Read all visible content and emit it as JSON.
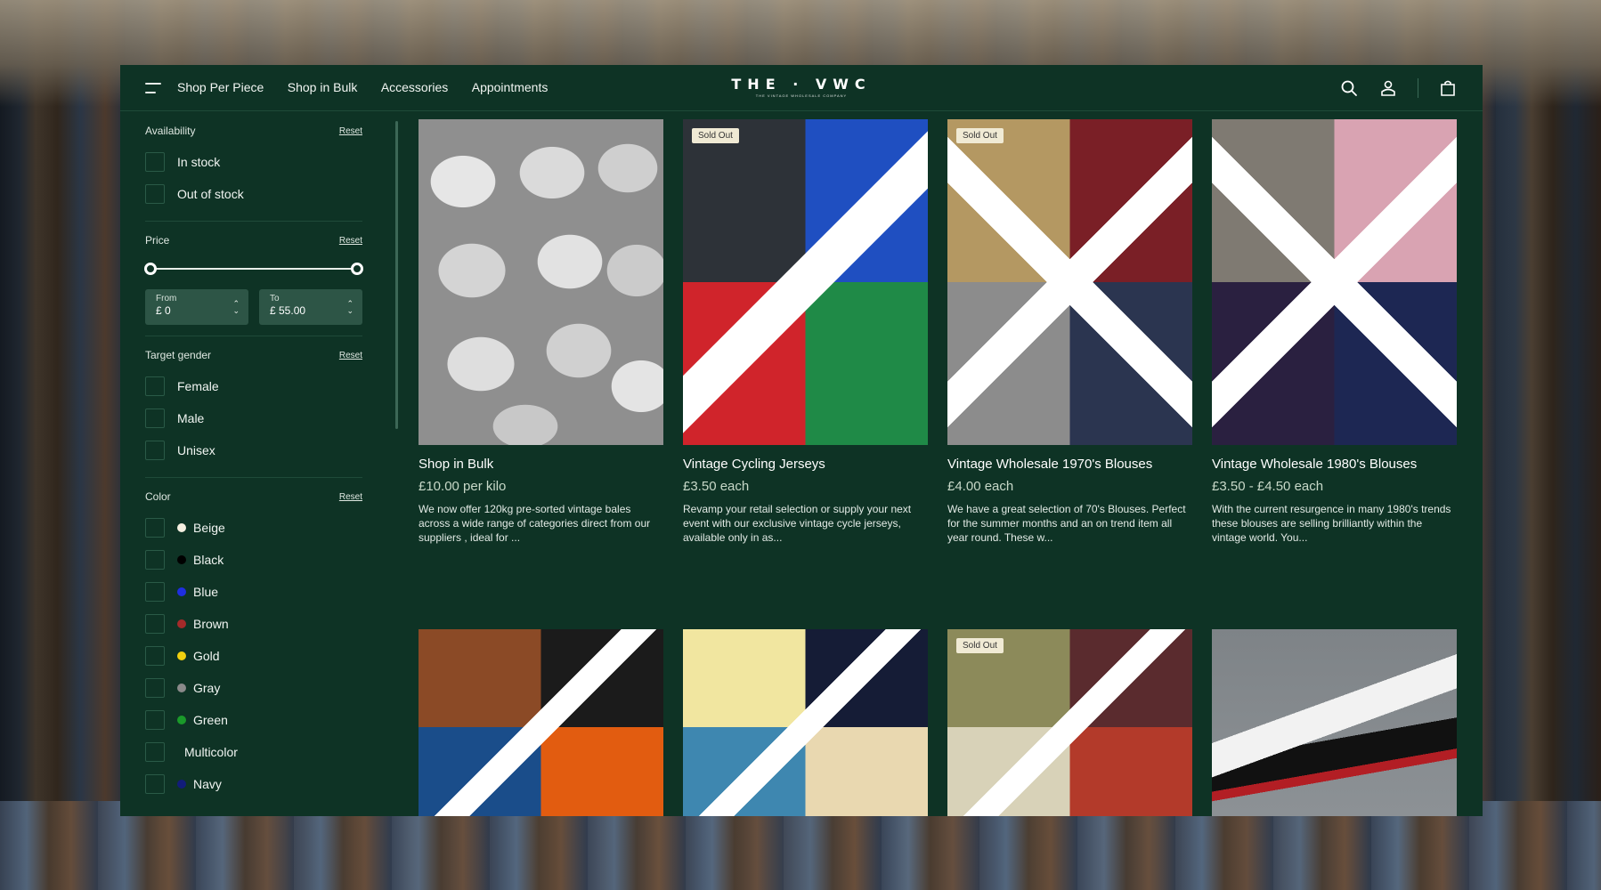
{
  "header": {
    "nav": [
      "Shop Per Piece",
      "Shop in Bulk",
      "Accessories",
      "Appointments"
    ],
    "logo_main": "THE · VWC",
    "logo_sub": "THE VINTAGE WHOLESALE COMPANY",
    "icons": [
      "search-icon",
      "account-icon",
      "cart-icon"
    ]
  },
  "filters": {
    "reset_label": "Reset",
    "availability": {
      "title": "Availability",
      "options": [
        "In stock",
        "Out of stock"
      ]
    },
    "price": {
      "title": "Price",
      "from_label": "From",
      "from_value": "£ 0",
      "to_label": "To",
      "to_value": "£ 55.00",
      "range": [
        0,
        55.0
      ]
    },
    "gender": {
      "title": "Target gender",
      "options": [
        "Female",
        "Male",
        "Unisex"
      ]
    },
    "color": {
      "title": "Color",
      "options": [
        {
          "label": "Beige",
          "swatch": "#f5f0e1"
        },
        {
          "label": "Black",
          "swatch": "#000000"
        },
        {
          "label": "Blue",
          "swatch": "#1f2ee0"
        },
        {
          "label": "Brown",
          "swatch": "#a52a2a"
        },
        {
          "label": "Gold",
          "swatch": "#f2d10f"
        },
        {
          "label": "Gray",
          "swatch": "#8a8a8a"
        },
        {
          "label": "Green",
          "swatch": "#1a9a2a"
        },
        {
          "label": "Multicolor",
          "swatch": ""
        },
        {
          "label": "Navy",
          "swatch": "#121c7a"
        }
      ]
    }
  },
  "products": [
    {
      "title": "Shop in Bulk",
      "price": "£10.00 per kilo",
      "desc": "We  now offer 120kg pre-sorted vintage bales across a wide range of categories direct from our suppliers , ideal for ...",
      "badge": ""
    },
    {
      "title": "Vintage Cycling Jerseys",
      "price": "£3.50 each",
      "desc": "Revamp your retail selection or supply your next event with our exclusive vintage cycle jerseys, available only in as...",
      "badge": "Sold Out"
    },
    {
      "title": "Vintage Wholesale 1970's Blouses",
      "price": "£4.00 each",
      "desc": "We have a great selection of 70's Blouses. Perfect for the summer months and an on trend item all year round. These w...",
      "badge": "Sold Out"
    },
    {
      "title": "Vintage Wholesale 1980's Blouses",
      "price": "£3.50 - £4.50 each",
      "desc": "With the current resurgence in many 1980's trends these blouses are selling brilliantly within the vintage world. You...",
      "badge": ""
    },
    {
      "title": "",
      "price": "",
      "desc": "",
      "badge": ""
    },
    {
      "title": "",
      "price": "",
      "desc": "",
      "badge": ""
    },
    {
      "title": "",
      "price": "",
      "desc": "",
      "badge": "Sold Out"
    },
    {
      "title": "",
      "price": "",
      "desc": "",
      "badge": ""
    }
  ]
}
